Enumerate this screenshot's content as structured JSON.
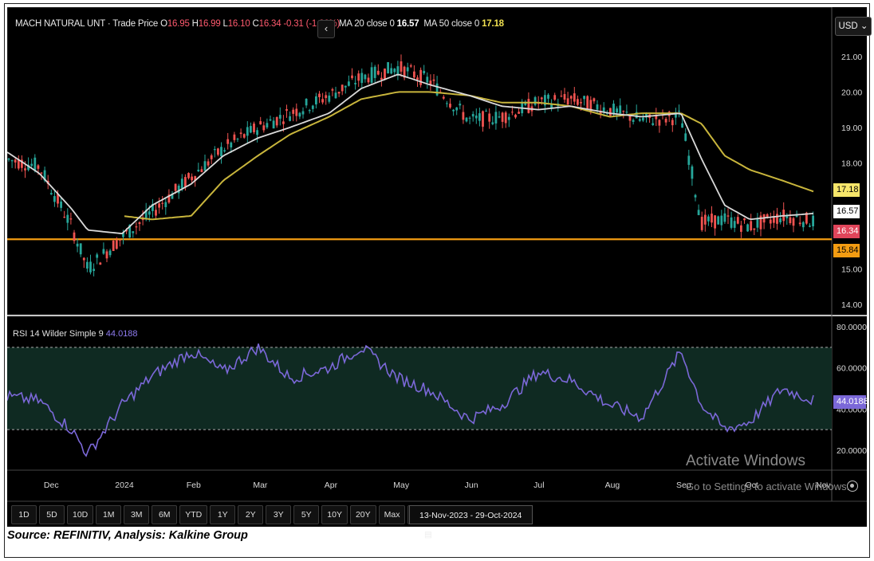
{
  "header": {
    "instrument": "MACH NATURAL UNT · Trade Price",
    "o_label": "O",
    "o_value": "16.95",
    "h_label": "H",
    "h_value": "16.99",
    "l_label": "L",
    "l_value": "16.10",
    "c_label": "C",
    "c_value": "16.34",
    "change": "-0.31 (-1.86%)",
    "ma20_label": "MA 20 close 0",
    "ma20_value": "16.57",
    "ma50_label": "MA 50 close 0",
    "ma50_value": "17.18"
  },
  "currency": "USD",
  "rsi_header": {
    "label": "RSI 14 Wilder Simple 9",
    "value": "44.0188"
  },
  "price_tags": [
    {
      "value": "17.18",
      "bg": "#f7e66a",
      "fg": "#000000"
    },
    {
      "value": "16.57",
      "bg": "#ffffff",
      "fg": "#000000"
    },
    {
      "value": "16.34",
      "bg": "#e0455a",
      "fg": "#ffffff"
    },
    {
      "value": "15.84",
      "bg": "#f39c12",
      "fg": "#000000"
    }
  ],
  "rsi_tag": {
    "value": "44.0188",
    "bg": "#7b68d8",
    "fg": "#ffffff"
  },
  "timeframes": [
    "1D",
    "5D",
    "10D",
    "1M",
    "3M",
    "6M",
    "YTD",
    "1Y",
    "2Y",
    "3Y",
    "5Y",
    "10Y",
    "20Y",
    "Max"
  ],
  "date_range": "13-Nov-2023 - 29-Oct-2024",
  "watermark": {
    "line1": "Activate Windows",
    "line2": "Go to Settings to activate Windows."
  },
  "source": "Source: REFINITIV, Analysis: Kalkine Group",
  "colors": {
    "background": "#000000",
    "up": "#26a69a",
    "down": "#ef5350",
    "ma20": "#d9d9d9",
    "ma50": "#c8b53c",
    "support": "#f39c12",
    "rsi_line": "#7b68d8",
    "rsi_band": "#0f2a22"
  },
  "chart_data": [
    {
      "type": "line",
      "panel": "price",
      "ylim": [
        14.0,
        21.0
      ],
      "y_ticks": [
        "21.00",
        "20.00",
        "19.00",
        "18.00",
        "16.57",
        "16.00",
        "15.00",
        "14.00"
      ],
      "x_tick_labels": [
        "Dec",
        "2024",
        "Feb",
        "Mar",
        "Apr",
        "May",
        "Jun",
        "Jul",
        "Aug",
        "Sep",
        "Oct",
        "Nov"
      ],
      "x": [
        "2023-11-13",
        "2023-11-27",
        "2023-12-11",
        "2023-12-18",
        "2024-01-02",
        "2024-01-15",
        "2024-02-01",
        "2024-02-15",
        "2024-03-01",
        "2024-03-15",
        "2024-04-01",
        "2024-04-15",
        "2024-05-01",
        "2024-05-15",
        "2024-06-01",
        "2024-06-15",
        "2024-07-01",
        "2024-07-15",
        "2024-08-01",
        "2024-08-15",
        "2024-09-01",
        "2024-09-10",
        "2024-09-20",
        "2024-10-01",
        "2024-10-15",
        "2024-10-29"
      ],
      "series": [
        {
          "name": "Trade Price",
          "values": [
            18.1,
            17.9,
            16.2,
            15.0,
            15.9,
            16.6,
            17.6,
            18.4,
            19.0,
            19.4,
            19.9,
            20.4,
            20.7,
            20.3,
            19.2,
            19.3,
            19.7,
            19.8,
            19.5,
            19.2,
            19.3,
            16.3,
            16.4,
            16.2,
            16.5,
            16.34
          ]
        },
        {
          "name": "MA 20",
          "values": [
            18.3,
            17.7,
            16.7,
            16.1,
            16.0,
            16.8,
            17.4,
            18.2,
            18.7,
            19.0,
            19.4,
            20.1,
            20.5,
            20.2,
            19.9,
            19.6,
            19.5,
            19.6,
            19.4,
            19.3,
            19.4,
            18.1,
            16.8,
            16.4,
            16.5,
            16.57
          ]
        },
        {
          "name": "MA 50",
          "values": [
            null,
            null,
            null,
            null,
            16.5,
            16.4,
            16.5,
            17.5,
            18.2,
            18.8,
            19.3,
            19.8,
            20.0,
            20.0,
            19.9,
            19.7,
            19.7,
            19.6,
            19.3,
            19.4,
            19.4,
            19.1,
            18.2,
            17.8,
            17.5,
            17.18
          ]
        }
      ],
      "horizontal_line": {
        "value": 15.84,
        "label": "15.84"
      }
    },
    {
      "type": "line",
      "panel": "rsi",
      "title": "RSI 14 Wilder Simple 9",
      "ylim": [
        15,
        80
      ],
      "y_ticks": [
        "80.0000",
        "60.0000",
        "40.0000",
        "20.0000"
      ],
      "overbought": 70,
      "oversold": 30,
      "x": [
        "2023-11-13",
        "2023-11-27",
        "2023-12-11",
        "2023-12-18",
        "2024-01-02",
        "2024-01-15",
        "2024-02-01",
        "2024-02-15",
        "2024-03-01",
        "2024-03-15",
        "2024-04-01",
        "2024-04-15",
        "2024-05-01",
        "2024-05-15",
        "2024-06-01",
        "2024-06-15",
        "2024-07-01",
        "2024-07-15",
        "2024-08-01",
        "2024-08-15",
        "2024-09-01",
        "2024-09-10",
        "2024-09-20",
        "2024-10-01",
        "2024-10-15",
        "2024-10-29"
      ],
      "series": [
        {
          "name": "RSI",
          "values": [
            46,
            44,
            30,
            18,
            42,
            56,
            68,
            58,
            70,
            55,
            60,
            70,
            55,
            49,
            35,
            42,
            58,
            54,
            42,
            36,
            68,
            42,
            30,
            34,
            50,
            44
          ]
        }
      ]
    }
  ]
}
